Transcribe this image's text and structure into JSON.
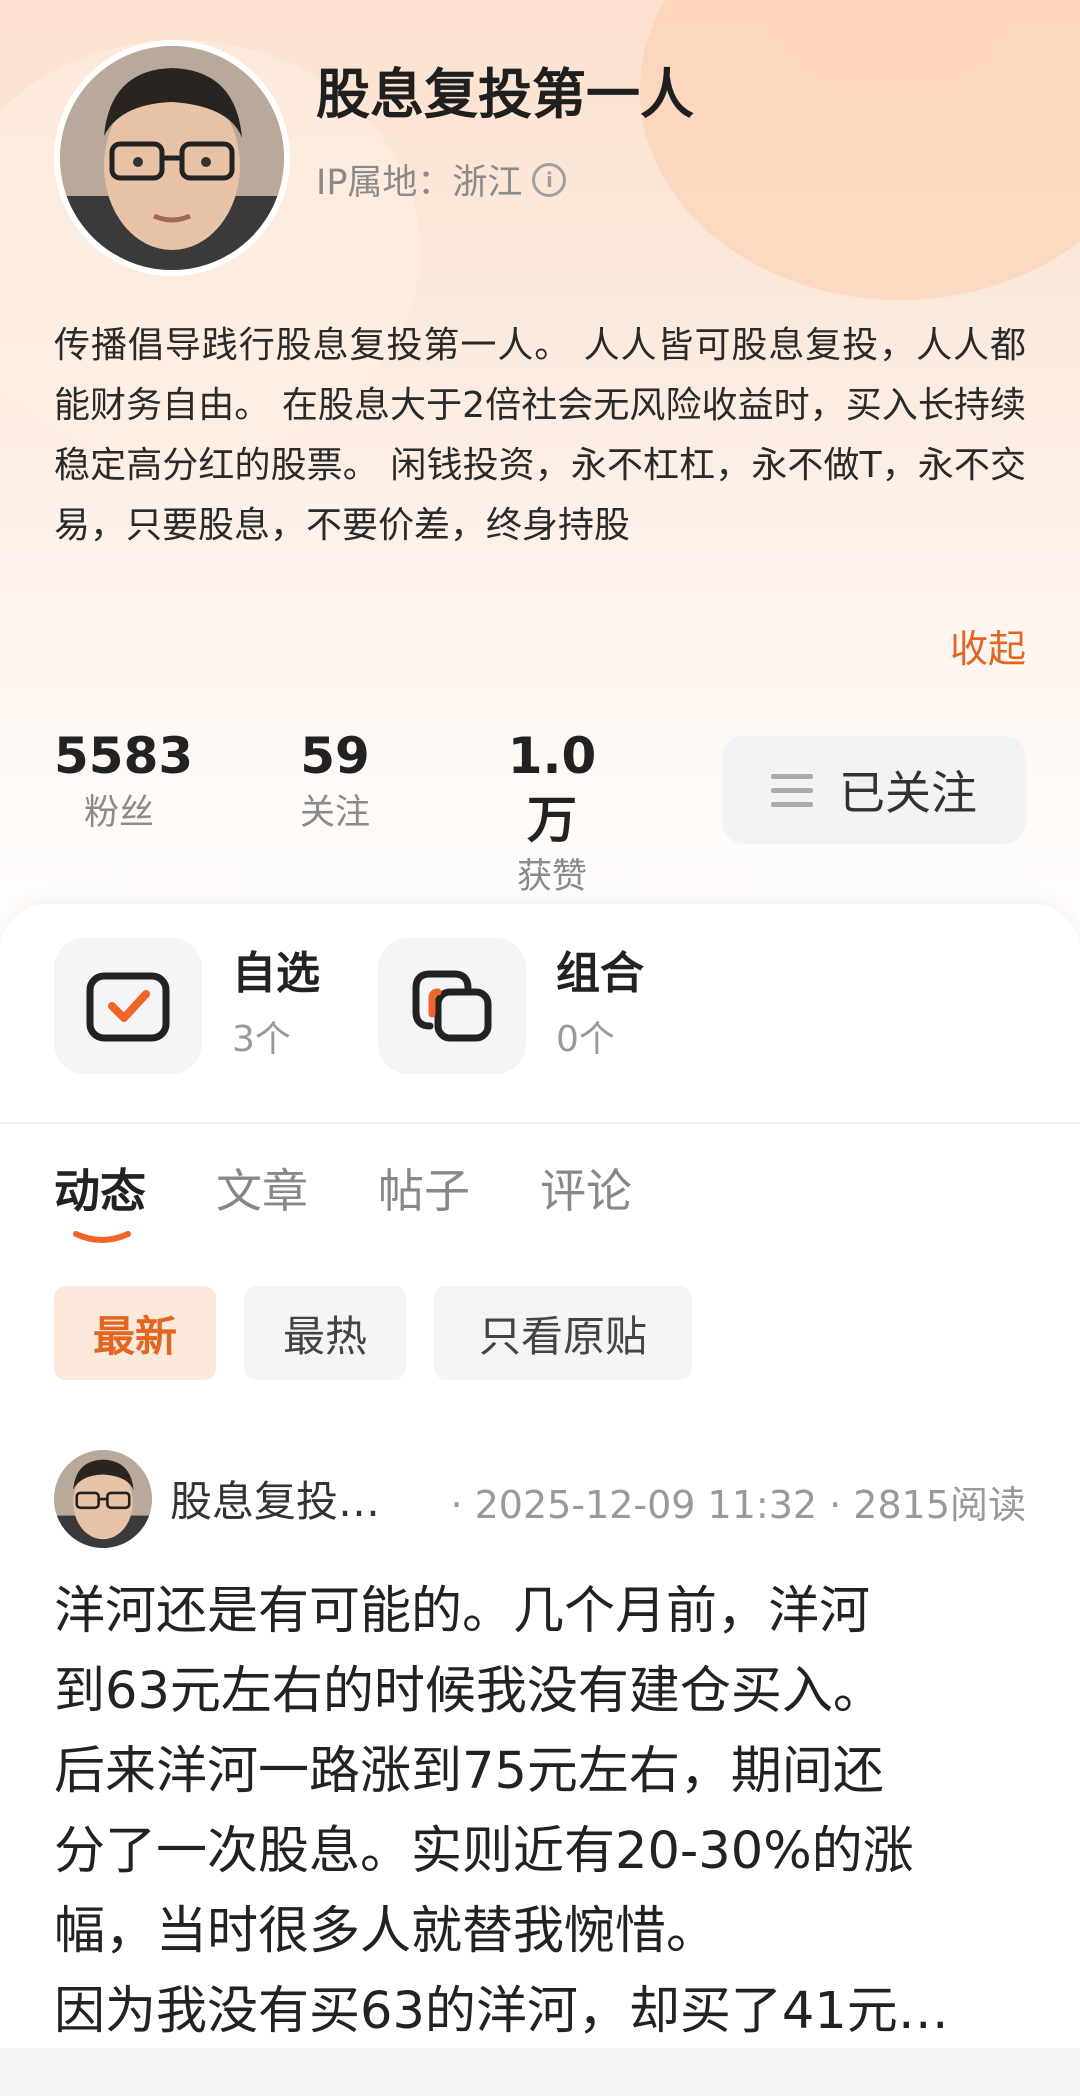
{
  "profile": {
    "name": "股息复投第一人",
    "ip_location": "IP属地：浙江",
    "bio": "传播倡导践行股息复投第一人。 人人皆可股息复投，人人都能财务自由。 在股息大于2倍社会无风险收益时，买入长持续稳定高分红的股票。 闲钱投资，永不杠杠，永不做T，永不交易，只要股息，不要价差，终身持股",
    "collapse_label": "收起"
  },
  "stats": [
    {
      "value": "5583",
      "label": "粉丝"
    },
    {
      "value": "59",
      "label": "关注"
    },
    {
      "value": "1.0万",
      "label": "获赞"
    }
  ],
  "follow_button": {
    "label": "已关注"
  },
  "quick_links": [
    {
      "title": "自选",
      "count": "3个",
      "icon": "checkbox-icon"
    },
    {
      "title": "组合",
      "count": "0个",
      "icon": "portfolio-icon"
    }
  ],
  "tabs": [
    "动态",
    "文章",
    "帖子",
    "评论"
  ],
  "active_tab": "动态",
  "filters": [
    "最新",
    "最热",
    "只看原贴"
  ],
  "active_filter": "最新",
  "post": {
    "author": "股息复投…",
    "meta": "· 2025-12-09 11:32 · 2815阅读",
    "lines": [
      "洋河还是有可能的。几个月前，洋河",
      "到63元左右的时候我没有建仓买入。",
      "后来洋河一路涨到75元左右，期间还",
      "分了一次股息。实则近有20-30%的涨",
      "幅，当时很多人就替我惋惜。",
      "因为我没有买63的洋河，却买了41元…"
    ]
  },
  "colors": {
    "accent": "#e2661f",
    "accent_bg": "#fde8dc",
    "header_gradient_top": "#fde2cf"
  }
}
